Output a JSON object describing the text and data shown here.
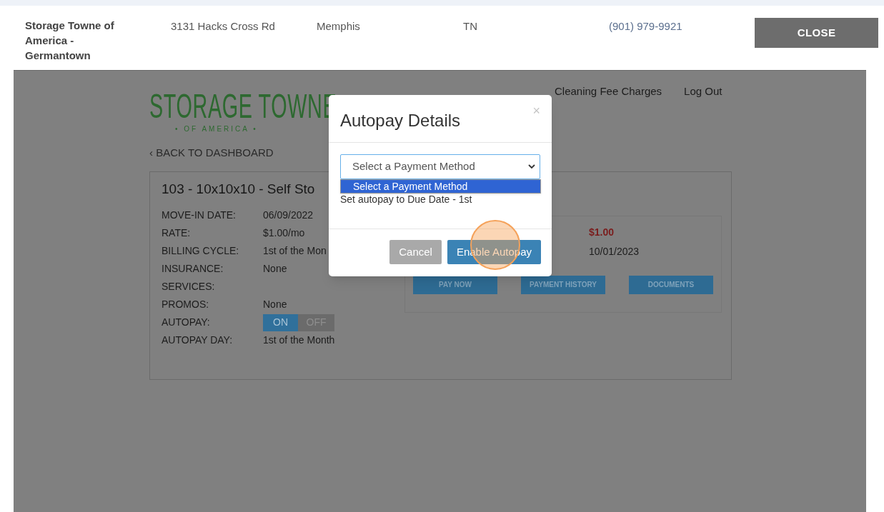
{
  "location_row": {
    "name": "Storage Towne of America - Germantown",
    "address": "3131 Hacks Cross Rd",
    "city": "Memphis",
    "state": "TN",
    "phone": "(901) 979-9921",
    "close_button": "CLOSE"
  },
  "portal": {
    "logo": {
      "title": "STORAGE TOWNE",
      "subtitle": "• OF AMERICA •"
    },
    "nav": [
      "Cleaning Fee Charges",
      "Log Out"
    ],
    "back_link": "‹ BACK TO DASHBOARD",
    "unit": {
      "title": "103 - 10x10x10 - Self Sto",
      "details": [
        {
          "kind": "text",
          "label": "MOVE-IN DATE:",
          "value": "06/09/2022"
        },
        {
          "kind": "text",
          "label": "RATE:",
          "value": "$1.00/mo"
        },
        {
          "kind": "text",
          "label": "BILLING CYCLE:",
          "value": "1st of the Mon"
        },
        {
          "kind": "text",
          "label": "INSURANCE:",
          "value": "None"
        },
        {
          "kind": "text",
          "label": "SERVICES:"
        },
        {
          "kind": "text",
          "label": "PROMOS:",
          "value": "None"
        },
        {
          "kind": "toggle",
          "label": "AUTOPAY:",
          "options": [
            {
              "label": "ON",
              "selected": true
            },
            {
              "label": "OFF",
              "selected": false
            }
          ]
        },
        {
          "kind": "text",
          "label": "AUTOPAY DAY:",
          "value": "1st of the Month"
        }
      ]
    },
    "billing": {
      "amount": "$1.00",
      "date": "10/01/2023",
      "buttons": [
        "PAY NOW",
        "PAYMENT HISTORY",
        "DOCUMENTS"
      ]
    }
  },
  "modal": {
    "title": "Autopay Details",
    "close": "×",
    "select": {
      "value": "Select a Payment Method",
      "expanded": true,
      "options": [
        {
          "label": "Select a Payment Method",
          "selected": true
        }
      ]
    },
    "note": "Set autopay to Due Date - 1st",
    "buttons": [
      {
        "label": "Cancel",
        "kind": "secondary"
      },
      {
        "label": "Enable Autopay",
        "kind": "primary"
      }
    ]
  }
}
